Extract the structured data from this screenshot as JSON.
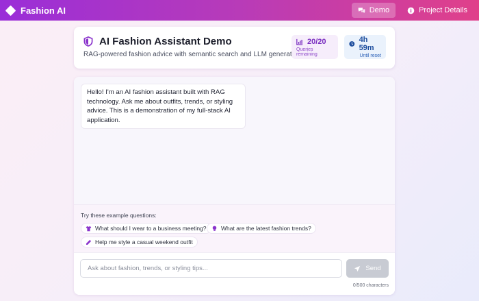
{
  "nav": {
    "brand": "Fashion AI",
    "items": [
      {
        "label": "Demo",
        "icon": "chat-bubbles-icon",
        "active": true
      },
      {
        "label": "Project Details",
        "icon": "info-icon",
        "active": false
      }
    ]
  },
  "header": {
    "title": "AI Fashion Assistant Demo",
    "subtitle": "RAG-powered fashion advice with semantic search and LLM generation",
    "icon": "shield-icon",
    "queries": {
      "value": "20/20",
      "label": "Queries remaining",
      "icon": "bar-chart-icon"
    },
    "reset": {
      "value": "4h 59m",
      "label": "Until reset",
      "icon": "clock-icon"
    }
  },
  "chat": {
    "messages": [
      {
        "role": "assistant",
        "text": "Hello! I'm an AI fashion assistant built with RAG technology. Ask me about outfits, trends, or styling advice. This is a demonstration of my full-stack AI application."
      }
    ],
    "examples_label": "Try these example questions:",
    "examples": [
      {
        "text": "What should I wear to a business meeting?",
        "icon": "shirt-icon"
      },
      {
        "text": "What are the latest fashion trends?",
        "icon": "lightbulb-icon"
      },
      {
        "text": "Help me style a casual weekend outfit",
        "icon": "pencil-icon"
      }
    ],
    "input_placeholder": "Ask about fashion, trends, or styling tips...",
    "input_value": "",
    "send_label": "Send",
    "char_count": "0/500 characters"
  },
  "colors": {
    "accent": "#9a2ed8",
    "accent_pink": "#e0408a",
    "queries_text": "#7a2fc0",
    "reset_text": "#1e4e9e",
    "send_disabled": "#c8cbd3"
  }
}
